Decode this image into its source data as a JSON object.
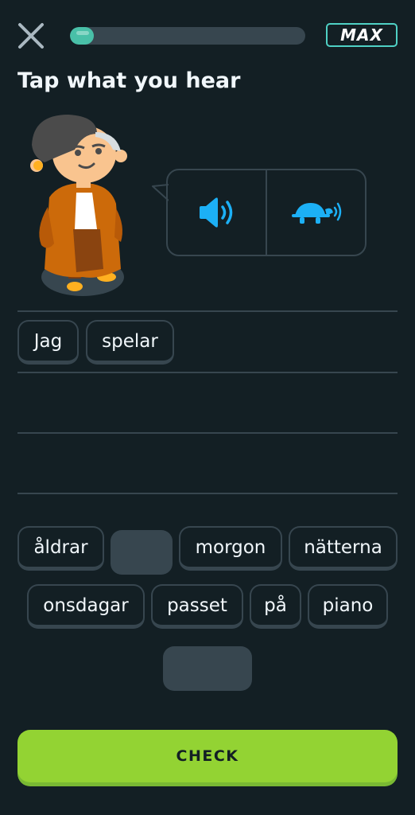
{
  "header": {
    "progress_fraction": 0.1,
    "badge_label": "MAX"
  },
  "prompt": {
    "title": "Tap what you hear"
  },
  "audio": {
    "normal_icon": "speaker-icon",
    "slow_icon": "turtle-icon"
  },
  "answer": {
    "selected_words": [
      "Jag",
      "spelar"
    ]
  },
  "word_bank": {
    "row1": [
      "åldrar",
      "",
      "morgon",
      "nätterna"
    ],
    "row2": [
      "onsdagar",
      "passet",
      "på",
      "piano"
    ]
  },
  "footer": {
    "check_label": "CHECK"
  },
  "colors": {
    "background": "#131f24",
    "border": "#37464f",
    "accent_blue": "#1cb0f6",
    "progress": "#49c0a8",
    "check_green": "#93d333"
  }
}
